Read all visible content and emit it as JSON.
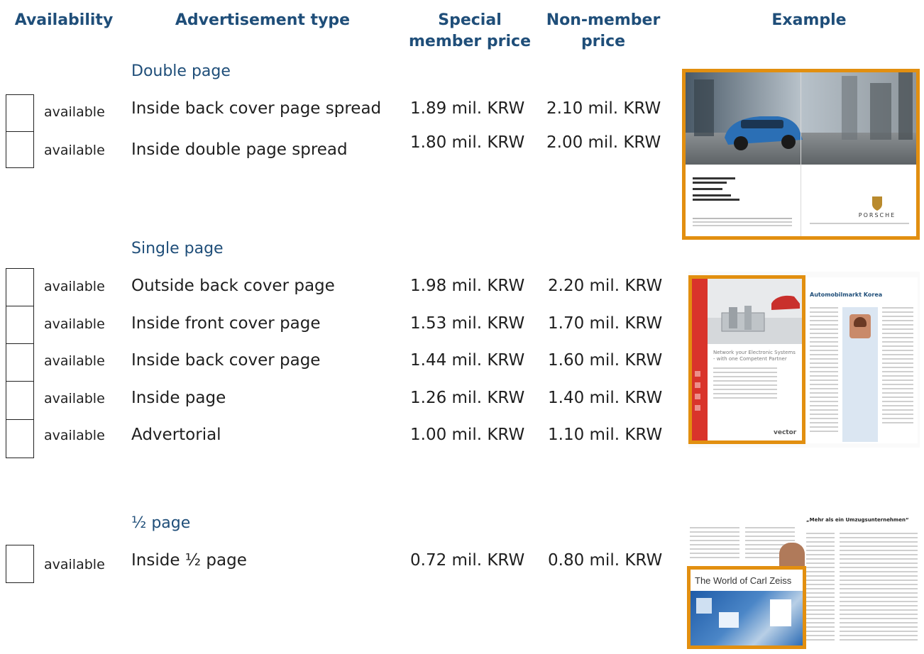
{
  "headers": {
    "availability": "Availability",
    "ad_type": "Advertisement type",
    "member_line1": "Special",
    "member_line2": "member price",
    "nonmember_line1": "Non-member",
    "nonmember_line2": "price",
    "example": "Example"
  },
  "sections": [
    {
      "title": "Double page",
      "rows": [
        {
          "availability": "available",
          "type": "Inside back cover page spread",
          "member": "1.89 mil. KRW",
          "nonmember": "2.10 mil. KRW"
        },
        {
          "availability": "available",
          "type": "Inside double page spread",
          "member": "1.80 mil. KRW",
          "nonmember": "2.00 mil. KRW"
        }
      ]
    },
    {
      "title": "Single page",
      "rows": [
        {
          "availability": "available",
          "type": "Outside back cover page",
          "member": "1.98 mil. KRW",
          "nonmember": "2.20 mil. KRW"
        },
        {
          "availability": "available",
          "type": "Inside front cover page",
          "member": "1.53 mil. KRW",
          "nonmember": "1.70 mil. KRW"
        },
        {
          "availability": "available",
          "type": "Inside back cover page",
          "member": "1.44 mil. KRW",
          "nonmember": "1.60 mil. KRW"
        },
        {
          "availability": "available",
          "type": "Inside page",
          "member": "1.26 mil. KRW",
          "nonmember": "1.40 mil. KRW"
        },
        {
          "availability": "available",
          "type": "Advertorial",
          "member": "1.00 mil. KRW",
          "nonmember": "1.10 mil. KRW"
        }
      ]
    },
    {
      "title": "½ page",
      "rows": [
        {
          "availability": "available",
          "type": "Inside ½ page",
          "member": "0.72 mil. KRW",
          "nonmember": "0.80 mil. KRW"
        }
      ]
    }
  ],
  "examples": {
    "double": {
      "brand": "PORSCHE"
    },
    "single": {
      "ad_headline": "Network your Electronic Systems - with one Competent Partner",
      "ad_brand": "vector",
      "article_title": "Automobilmarkt Korea"
    },
    "half": {
      "ad_title": "The World of Carl Zeiss",
      "article_title": "„Mehr als ein Umzugsunternehmen“"
    }
  },
  "colors": {
    "heading": "#1f4e79",
    "frame": "#e28f10",
    "ad_red": "#d9342b",
    "car_blue": "#2b6fb5"
  }
}
